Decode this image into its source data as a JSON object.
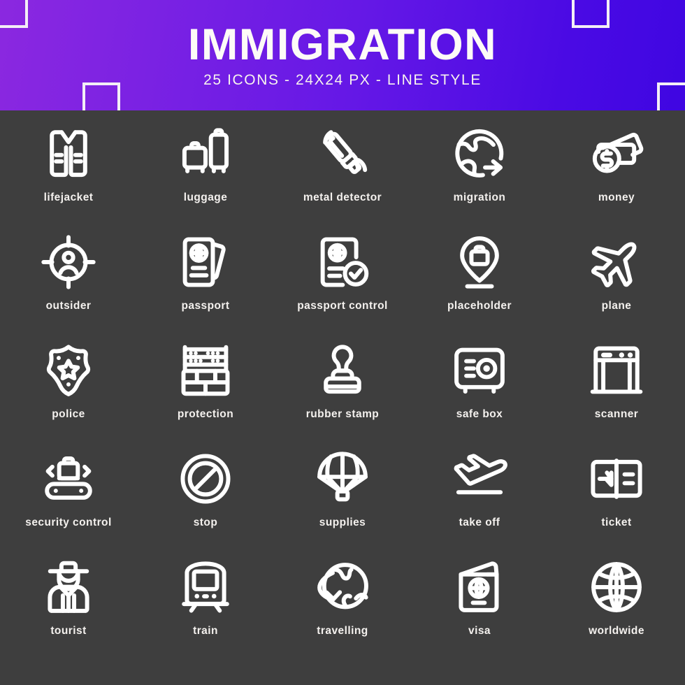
{
  "header": {
    "title": "IMMIGRATION",
    "subtitle": "25 ICONS - 24X24 PX - LINE STYLE",
    "gradient_start": "#8b28e0",
    "gradient_end": "#3f06e2",
    "text_color": "#fdfbf7",
    "decor_color": "#f3eef6"
  },
  "canvas": {
    "background": "#3e3e3e",
    "icon_color": "#ffffff",
    "label_color": "#f4f1ee",
    "columns": 5,
    "rows": 5,
    "icon_count": 25
  },
  "icons": [
    {
      "label": "lifejacket",
      "icon": "lifejacket-icon"
    },
    {
      "label": "luggage",
      "icon": "luggage-icon"
    },
    {
      "label": "metal detector",
      "icon": "metal-detector-icon"
    },
    {
      "label": "migration",
      "icon": "migration-icon"
    },
    {
      "label": "money",
      "icon": "money-icon"
    },
    {
      "label": "outsider",
      "icon": "outsider-icon"
    },
    {
      "label": "passport",
      "icon": "passport-icon"
    },
    {
      "label": "passport control",
      "icon": "passport-control-icon"
    },
    {
      "label": "placeholder",
      "icon": "placeholder-icon"
    },
    {
      "label": "plane",
      "icon": "plane-icon"
    },
    {
      "label": "police",
      "icon": "police-icon"
    },
    {
      "label": "protection",
      "icon": "protection-icon"
    },
    {
      "label": "rubber stamp",
      "icon": "rubber-stamp-icon"
    },
    {
      "label": "safe box",
      "icon": "safe-box-icon"
    },
    {
      "label": "scanner",
      "icon": "scanner-icon"
    },
    {
      "label": "security control",
      "icon": "security-control-icon"
    },
    {
      "label": "stop",
      "icon": "stop-icon"
    },
    {
      "label": "supplies",
      "icon": "supplies-icon"
    },
    {
      "label": "take off",
      "icon": "take-off-icon"
    },
    {
      "label": "ticket",
      "icon": "ticket-icon"
    },
    {
      "label": "tourist",
      "icon": "tourist-icon"
    },
    {
      "label": "train",
      "icon": "train-icon"
    },
    {
      "label": "travelling",
      "icon": "travelling-icon"
    },
    {
      "label": "visa",
      "icon": "visa-icon"
    },
    {
      "label": "worldwide",
      "icon": "worldwide-icon"
    }
  ]
}
